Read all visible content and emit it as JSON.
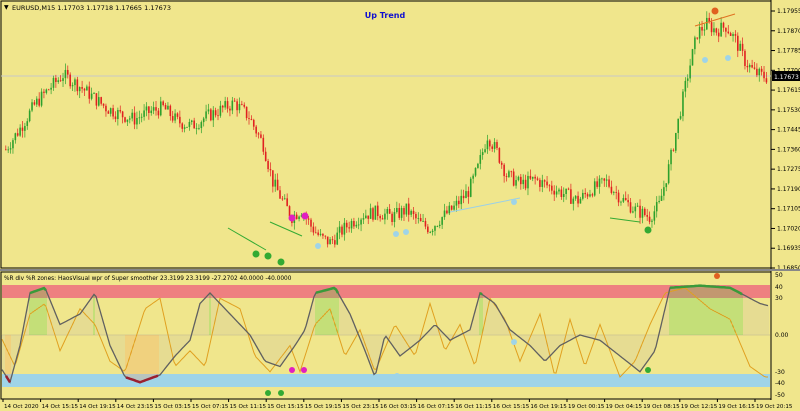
{
  "main_chart": {
    "symbol_info": "EURUSD,M15  1.17703 1.17718 1.17665 1.17673",
    "annotation": "Up Trend",
    "price_labels": [
      "1.17955",
      "1.17870",
      "1.17785",
      "1.17700",
      "1.17615",
      "1.17530",
      "1.17445",
      "1.17360",
      "1.17275",
      "1.17190",
      "1.17105",
      "1.17020",
      "1.16935",
      "1.16850"
    ],
    "current_price": "1.17673"
  },
  "indicator": {
    "title": "%R div  %R zones:  HaosVisual wpr of Super smoother 23.3199 23.3199 -27.2702 40.0000 -40.0000",
    "levels": [
      "50",
      "40",
      "30",
      "0.00",
      "-30",
      "-40",
      "-50"
    ],
    "zone_colors": {
      "upper": "#ee8080",
      "lower": "#9fd4e8"
    },
    "markers": {
      "top": "0",
      "bottom": "0"
    }
  },
  "time_labels": [
    "14 Oct 2020",
    "14 Oct 15:15",
    "14 Oct 19:15",
    "14 Oct 23:15",
    "15 Oct 03:15",
    "15 Oct 07:15",
    "15 Oct 11:15",
    "15 Oct 15:15",
    "15 Oct 19:15",
    "15 Oct 23:15",
    "16 Oct 03:15",
    "16 Oct 07:15",
    "16 Oct 11:15",
    "16 Oct 15:15",
    "16 Oct 19:15",
    "19 Oct 00:15",
    "19 Oct 04:15",
    "19 Oct 08:15",
    "19 Oct 12:15",
    "19 Oct 16:15",
    "19 Oct 20:15"
  ],
  "chart_data": {
    "type": "candlestick",
    "symbol": "EURUSD",
    "timeframe": "M15",
    "ohlc_last": {
      "open": 1.17703,
      "high": 1.17718,
      "low": 1.17665,
      "close": 1.17673
    },
    "price_path": [
      [
        0,
        1.1736
      ],
      [
        6,
        1.1745
      ],
      [
        12,
        1.1755
      ],
      [
        18,
        1.1762
      ],
      [
        24,
        1.1768
      ],
      [
        30,
        1.1764
      ],
      [
        36,
        1.1759
      ],
      [
        42,
        1.1754
      ],
      [
        48,
        1.1751
      ],
      [
        54,
        1.1749
      ],
      [
        60,
        1.1752
      ],
      [
        66,
        1.1754
      ],
      [
        72,
        1.1748
      ],
      [
        78,
        1.1746
      ],
      [
        84,
        1.175
      ],
      [
        90,
        1.1753
      ],
      [
        96,
        1.1756
      ],
      [
        102,
        1.175
      ],
      [
        108,
        1.1738
      ],
      [
        112,
        1.1722
      ],
      [
        116,
        1.1714
      ],
      [
        120,
        1.1707
      ],
      [
        124,
        1.171
      ],
      [
        128,
        1.1703
      ],
      [
        132,
        1.1698
      ],
      [
        136,
        1.1696
      ],
      [
        140,
        1.17
      ],
      [
        144,
        1.1704
      ],
      [
        150,
        1.1708
      ],
      [
        156,
        1.1709
      ],
      [
        162,
        1.1707
      ],
      [
        168,
        1.171
      ],
      [
        174,
        1.1704
      ],
      [
        178,
        1.1702
      ],
      [
        182,
        1.1706
      ],
      [
        188,
        1.1711
      ],
      [
        194,
        1.1718
      ],
      [
        198,
        1.1728
      ],
      [
        202,
        1.1742
      ],
      [
        206,
        1.1735
      ],
      [
        210,
        1.1725
      ],
      [
        216,
        1.1721
      ],
      [
        222,
        1.1723
      ],
      [
        228,
        1.172
      ],
      [
        234,
        1.1717
      ],
      [
        240,
        1.1714
      ],
      [
        246,
        1.1719
      ],
      [
        252,
        1.1722
      ],
      [
        258,
        1.1715
      ],
      [
        264,
        1.171
      ],
      [
        270,
        1.1707
      ],
      [
        274,
        1.1712
      ],
      [
        278,
        1.1728
      ],
      [
        282,
        1.1748
      ],
      [
        286,
        1.1768
      ],
      [
        290,
        1.1786
      ],
      [
        294,
        1.179
      ],
      [
        298,
        1.1787
      ],
      [
        302,
        1.1789
      ],
      [
        306,
        1.1783
      ],
      [
        310,
        1.1774
      ],
      [
        314,
        1.1769
      ],
      [
        319,
        1.1767
      ]
    ],
    "indicator_levels": {
      "upper": 40,
      "lower": -40
    }
  }
}
